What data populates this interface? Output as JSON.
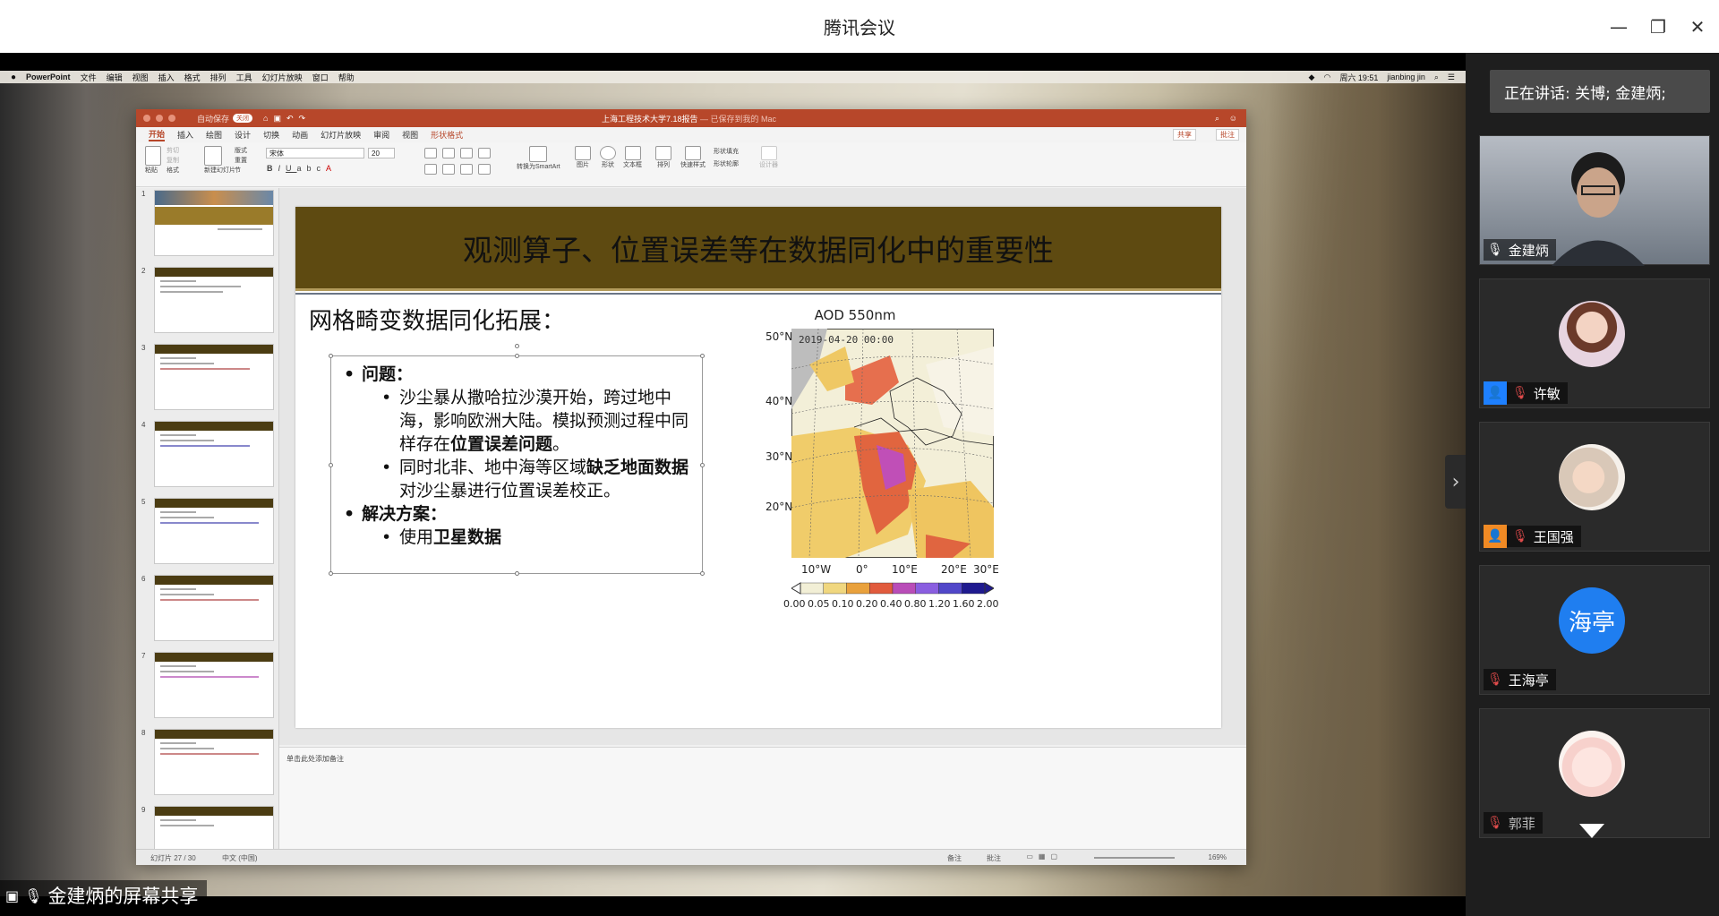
{
  "window": {
    "title": "腾讯会议",
    "min_glyph": "—",
    "restore_glyph": "❐",
    "close_glyph": "✕"
  },
  "mac_menubar": {
    "apple": "",
    "app": "PowerPoint",
    "menus": [
      "文件",
      "编辑",
      "视图",
      "插入",
      "格式",
      "排列",
      "工具",
      "幻灯片放映",
      "窗口",
      "帮助"
    ],
    "clock": "周六 19:51",
    "user": "jianbing jin"
  },
  "ppt": {
    "autosave": "自动保存",
    "autosave_state": "关闭",
    "document_title": "上海工程技术大学7.18报告",
    "document_saved": " — 已保存到我的 Mac",
    "tabs": [
      "开始",
      "插入",
      "绘图",
      "设计",
      "切换",
      "动画",
      "幻灯片放映",
      "审阅",
      "视图"
    ],
    "context_tab": "形状格式",
    "share_button": "共享",
    "comment_button": "批注",
    "font_name": "宋体",
    "font_size": "20",
    "ribbon_labels": {
      "paste": "粘贴",
      "cut": "剪切",
      "copy": "复制",
      "format": "格式",
      "new_slide": "新建幻灯片",
      "layout": "版式",
      "reset": "重置",
      "section": "节",
      "smartart": "转换为SmartArt",
      "picture": "图片",
      "shape": "形状",
      "textbox": "文本框",
      "arrange": "排列",
      "quick_styles": "快速样式",
      "shape_fill": "形状填充",
      "shape_outline": "形状轮廓",
      "designer": "设计器"
    },
    "thumbnail_numbers": [
      "1",
      "2",
      "3",
      "4",
      "5",
      "6",
      "7",
      "8",
      "9"
    ],
    "slide": {
      "title": "观测算子、位置误差等在数据同化中的重要性",
      "subtitle": "网格畸变数据同化拓展：",
      "bullet_problem": "问题：",
      "sub1_part1": "沙尘暴从撒哈拉沙漠开始，跨过地中海，影响欧洲大陆。模拟预测过程中同样存在",
      "sub1_bold": "位置误差问题",
      "sub1_end": "。",
      "sub2_part1": "同时北非、地中海等区域",
      "sub2_bold": "缺乏地面数据",
      "sub2_part2": "对沙尘暴进行位置误差校正。",
      "bullet_solution": "解决方案：",
      "sub3_part1": "使用",
      "sub3_bold": "卫星数据"
    },
    "map": {
      "title": "AOD 550nm",
      "timestamp": "2019-04-20 00:00",
      "lat_labels": [
        "50°N",
        "40°N",
        "30°N",
        "20°N"
      ],
      "lon_labels": [
        "10°W",
        "0°",
        "10°E",
        "20°E",
        "30°E"
      ],
      "colorbar_labels": [
        "0.00",
        "0.05",
        "0.10",
        "0.20",
        "0.40",
        "0.80",
        "1.20",
        "1.60",
        "2.00"
      ],
      "colorbar_colors": [
        "#ffffff",
        "#f2efd6",
        "#f0d77f",
        "#e9a13c",
        "#e15b3d",
        "#b94db8",
        "#8a5ee0",
        "#5147c9",
        "#1f1a8f"
      ]
    },
    "notes_placeholder": "单击此处添加备注",
    "status_slide": "幻灯片 27 / 30",
    "status_lang": "中文 (中国)",
    "status_notes": "备注",
    "status_comments": "批注",
    "status_zoom": "169%"
  },
  "share_badge": "金建炳的屏幕共享",
  "panel": {
    "speaking": "正在讲话: 关博; 金建炳;",
    "participants": [
      {
        "name": "金建炳",
        "muted": false
      },
      {
        "name": "许敏",
        "muted": true
      },
      {
        "name": "王国强",
        "muted": true
      },
      {
        "name": "王海亭",
        "muted": true,
        "avatar_text": "海亭"
      },
      {
        "name": "郭菲",
        "muted": true
      }
    ]
  }
}
